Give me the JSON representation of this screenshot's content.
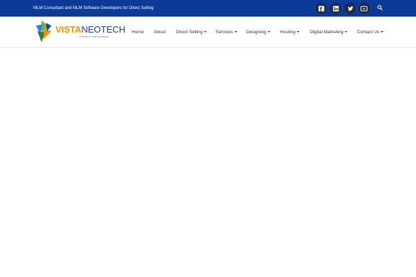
{
  "topbar": {
    "tagline": "MLM Consultant and MLM Software Developers for Direct Selling",
    "background_color": "#0b3a97",
    "social": [
      {
        "icon": "facebook-icon"
      },
      {
        "icon": "linkedin-icon"
      },
      {
        "icon": "twitter-icon"
      },
      {
        "icon": "youtube-icon"
      }
    ],
    "search_icon": "search-icon"
  },
  "logo": {
    "part1": "VISTA",
    "part2": "NEOTECH",
    "tagline": "IN PURSUIT OF EXCELLENCE"
  },
  "nav": {
    "items": [
      {
        "label": "Home",
        "has_dropdown": false
      },
      {
        "label": "About",
        "has_dropdown": false
      },
      {
        "label": "Direct Selling",
        "has_dropdown": true
      },
      {
        "label": "Services",
        "has_dropdown": true
      },
      {
        "label": "Designing",
        "has_dropdown": true
      },
      {
        "label": "Hosting",
        "has_dropdown": true
      },
      {
        "label": "Digital Marketing",
        "has_dropdown": true
      },
      {
        "label": "Contact Us",
        "has_dropdown": true
      }
    ]
  },
  "colors": {
    "accent_orange": "#f39200",
    "brand_blue": "#1d3c86"
  }
}
